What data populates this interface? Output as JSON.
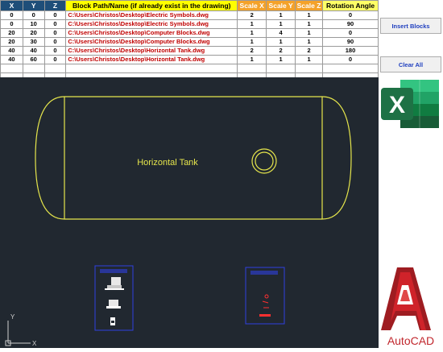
{
  "table": {
    "headers": {
      "x": "X",
      "y": "Y",
      "z": "Z",
      "path": "Block Path/Name (if already exist in the drawing)",
      "sx": "Scale X",
      "sy": "Scale Y",
      "sz": "Scale Z",
      "rot": "Rotation Angle"
    },
    "rows": [
      {
        "x": "0",
        "y": "0",
        "z": "0",
        "path": "C:\\Users\\Christos\\Desktop\\Electric Symbols.dwg",
        "sx": "2",
        "sy": "1",
        "sz": "1",
        "rot": "0"
      },
      {
        "x": "0",
        "y": "10",
        "z": "0",
        "path": "C:\\Users\\Christos\\Desktop\\Electric Symbols.dwg",
        "sx": "1",
        "sy": "1",
        "sz": "1",
        "rot": "90"
      },
      {
        "x": "20",
        "y": "20",
        "z": "0",
        "path": "C:\\Users\\Christos\\Desktop\\Computer Blocks.dwg",
        "sx": "1",
        "sy": "4",
        "sz": "1",
        "rot": "0"
      },
      {
        "x": "20",
        "y": "30",
        "z": "0",
        "path": "C:\\Users\\Christos\\Desktop\\Computer Blocks.dwg",
        "sx": "1",
        "sy": "1",
        "sz": "1",
        "rot": "90"
      },
      {
        "x": "40",
        "y": "40",
        "z": "0",
        "path": "C:\\Users\\Christos\\Desktop\\Horizontal Tank.dwg",
        "sx": "2",
        "sy": "2",
        "sz": "2",
        "rot": "180"
      },
      {
        "x": "40",
        "y": "60",
        "z": "0",
        "path": "C:\\Users\\Christos\\Desktop\\Horizontal Tank.dwg",
        "sx": "1",
        "sy": "1",
        "sz": "1",
        "rot": "0"
      }
    ]
  },
  "buttons": {
    "insert": "Insert Blocks",
    "clear": "Clear All"
  },
  "drawing": {
    "tank_label": "Horizontal Tank",
    "ucs_y": "Y",
    "ucs_x": "X"
  },
  "logos": {
    "excel_letter": "X",
    "autocad_letter": "A",
    "autocad_text": "AutoCAD"
  },
  "colors": {
    "cad_background": "#212830",
    "tank_line": "#e6e64c",
    "block_frame": "#2f3fe0",
    "path_text": "#c00000",
    "excel_green": "#1e7145",
    "autocad_red": "#c1272d"
  }
}
